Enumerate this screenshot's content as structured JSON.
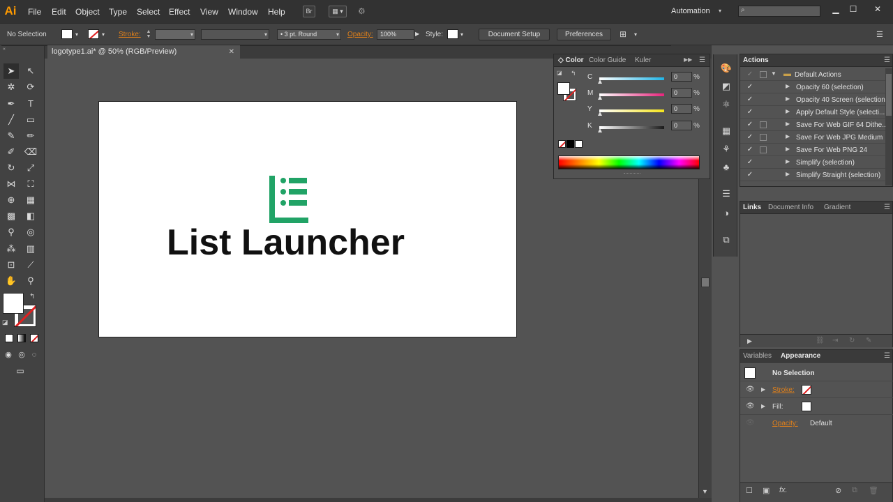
{
  "app": {
    "logo": "Ai",
    "menu": [
      "File",
      "Edit",
      "Object",
      "Type",
      "Select",
      "Effect",
      "View",
      "Window",
      "Help"
    ],
    "bridge_label": "Br",
    "workspace": "Automation"
  },
  "control": {
    "selection": "No Selection",
    "stroke_label": "Stroke:",
    "brush_label": "3 pt. Round",
    "opacity_label": "Opacity:",
    "opacity_value": "100%",
    "style_label": "Style:",
    "document_setup": "Document Setup",
    "preferences": "Preferences"
  },
  "document": {
    "tab_title": "logotype1.ai* @ 50% (RGB/Preview)",
    "logo_text": "List Launcher",
    "logo_color": "#21a366"
  },
  "color_panel": {
    "tabs": [
      "Color",
      "Color Guide",
      "Kuler"
    ],
    "channels": [
      {
        "label": "C",
        "value": "0",
        "color": "#20b5e8"
      },
      {
        "label": "M",
        "value": "0",
        "color": "#e8247c"
      },
      {
        "label": "Y",
        "value": "0",
        "color": "#f5e41c"
      },
      {
        "label": "K",
        "value": "0",
        "color": "#1a1a1a"
      }
    ],
    "percent": "%"
  },
  "actions_panel": {
    "title": "Actions",
    "set_name": "Default Actions",
    "items": [
      "Opacity 60 (selection)",
      "Opacity 40 Screen (selection)",
      "Apply Default Style (selecti...",
      "Save For Web GIF 64 Dithe...",
      "Save For Web JPG Medium",
      "Save For Web PNG 24",
      "Simplify (selection)",
      "Simplify Straight (selection)"
    ]
  },
  "links_panel": {
    "tabs": [
      "Links",
      "Document Info",
      "Gradient"
    ]
  },
  "appearance_panel": {
    "tabs": [
      "Variables",
      "Appearance"
    ],
    "title": "No Selection",
    "stroke_label": "Stroke:",
    "fill_label": "Fill:",
    "opacity_label": "Opacity:",
    "opacity_value": "Default"
  }
}
